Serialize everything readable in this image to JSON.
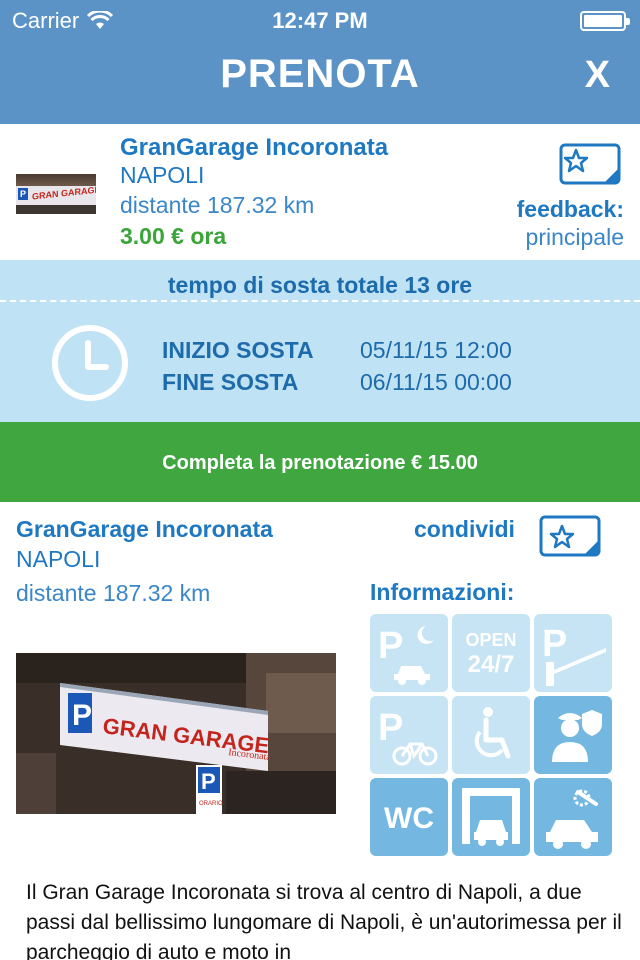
{
  "status_bar": {
    "carrier": "Carrier",
    "time": "12:47 PM"
  },
  "nav": {
    "title": "PRENOTA",
    "close": "X"
  },
  "garage": {
    "name": "GranGarage Incoronata",
    "city": "NAPOLI",
    "distance": "distante 187.32 km",
    "price": "3.00 € ora",
    "feedback_label": "feedback:",
    "feedback_value": "principale"
  },
  "booking": {
    "total": "tempo di sosta totale 13 ore",
    "start_label": "INIZIO SOSTA",
    "start_value": "05/11/15 12:00",
    "end_label": "FINE SOSTA",
    "end_value": "06/11/15 00:00"
  },
  "complete_button": "Completa la prenotazione € 15.00",
  "details": {
    "name": "GranGarage Incoronata",
    "city": "NAPOLI",
    "distance": "distante 187.32 km",
    "share_label": "condividi",
    "info_title": "Informazioni:"
  },
  "services": [
    {
      "icon": "night-parking-icon",
      "active": false
    },
    {
      "icon": "open-24-7-icon",
      "active": false,
      "text_line1": "OPEN",
      "text_line2": "24/7"
    },
    {
      "icon": "barrier-parking-icon",
      "active": false
    },
    {
      "icon": "bike-parking-icon",
      "active": false
    },
    {
      "icon": "wheelchair-icon",
      "active": false
    },
    {
      "icon": "custodian-icon",
      "active": true
    },
    {
      "icon": "wc-icon",
      "active": true,
      "text": "WC"
    },
    {
      "icon": "car-wash-icon",
      "active": true
    },
    {
      "icon": "car-service-icon",
      "active": true
    }
  ],
  "photo_sign": {
    "brand": "GRAN GARAGE",
    "sub": "Incoronata",
    "orario": "ORARIO"
  },
  "description": "Il Gran Garage Incoronata si trova al centro di Napoli, a due passi dal bellissimo lungomare di Napoli, è un'autorimessa per il parcheggio di auto e moto in",
  "colors": {
    "header": "#5b93c7",
    "accent_blue": "#1e78c2",
    "green": "#3fa640",
    "light_blue": "#bfe3f5"
  }
}
